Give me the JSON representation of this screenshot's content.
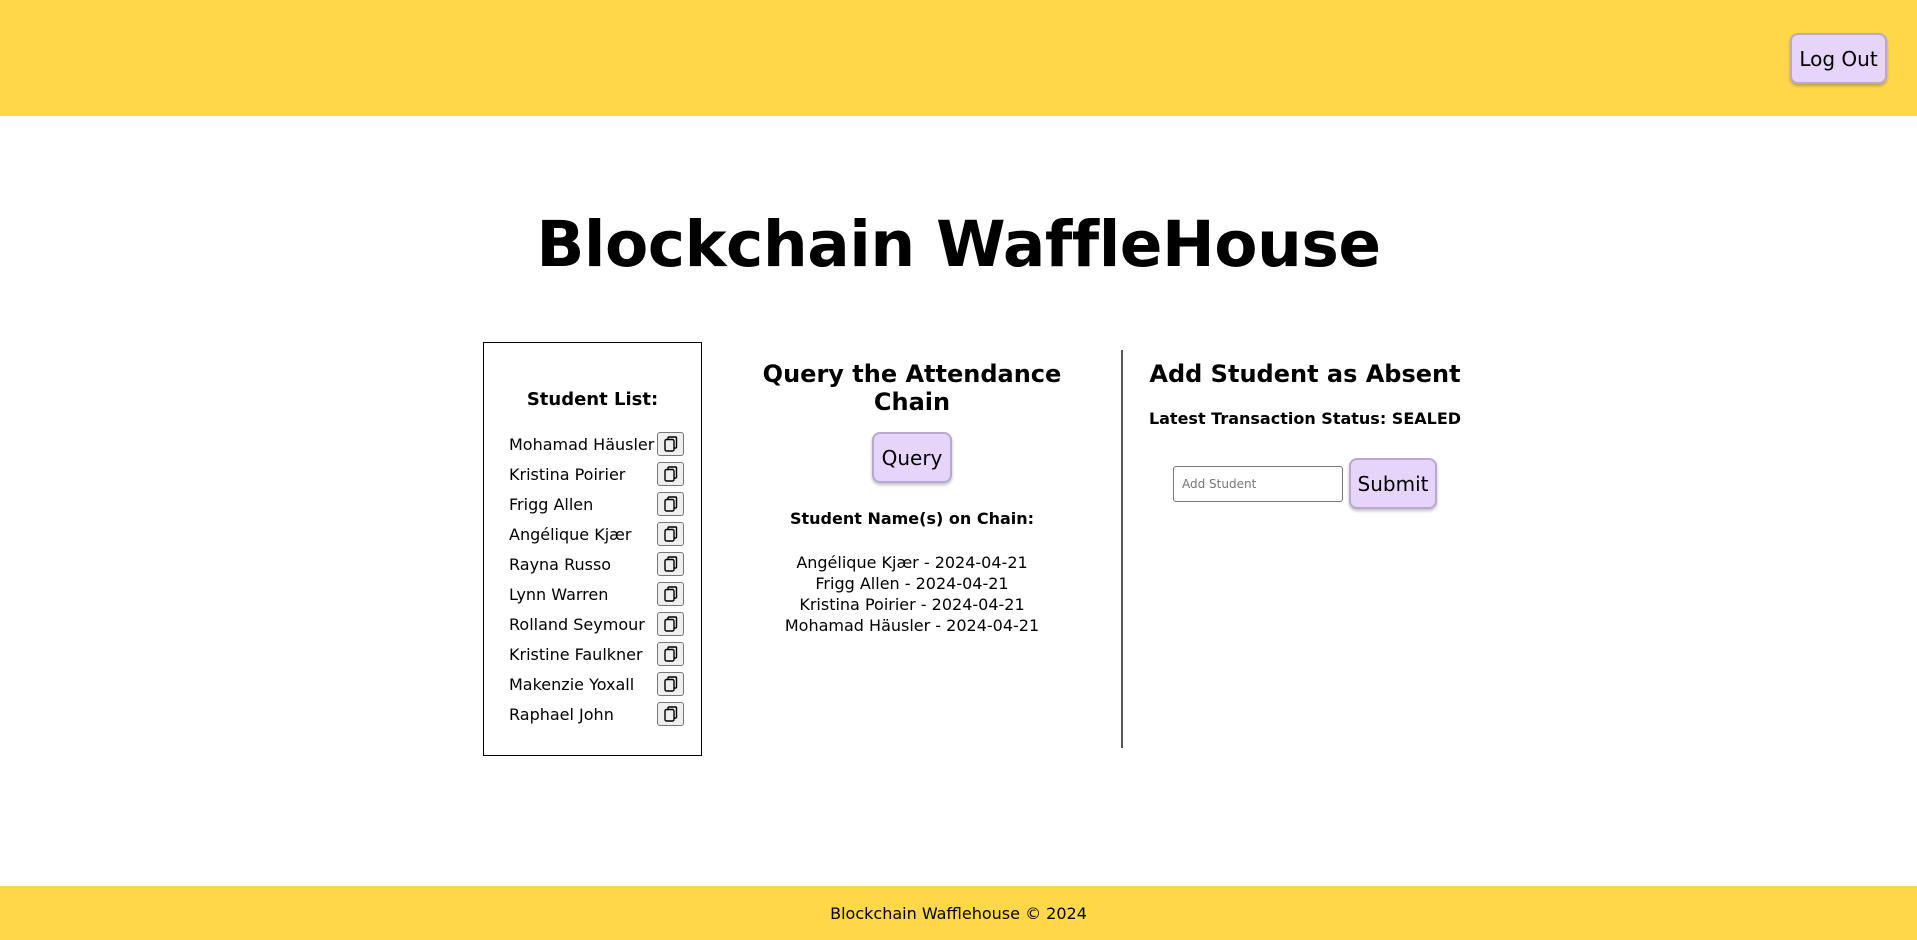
{
  "header": {
    "logout_label": "Log Out"
  },
  "page_title": "Blockchain WaffleHouse",
  "student_panel": {
    "title": "Student List:",
    "students": [
      "Mohamad Häusler",
      "Kristina Poirier",
      "Frigg Allen",
      "Angélique Kjær",
      "Rayna Russo",
      "Lynn Warren",
      "Rolland Seymour",
      "Kristine Faulkner",
      "Makenzie Yoxall",
      "Raphael John"
    ],
    "copy_icon": "copy-icon"
  },
  "query_section": {
    "title": "Query the Attendance Chain",
    "query_label": "Query",
    "chain_label": "Student Name(s) on Chain:",
    "chain_entries": [
      "Angélique Kjær - 2024-04-21",
      "Frigg Allen - 2024-04-21",
      "Kristina Poirier - 2024-04-21",
      "Mohamad Häusler - 2024-04-21"
    ]
  },
  "add_section": {
    "title": "Add Student as Absent",
    "tx_status": "Latest Transaction Status: SEALED",
    "input_placeholder": "Add Student",
    "input_value": "",
    "submit_label": "Submit"
  },
  "footer": {
    "text": "Blockchain Wafflehouse © 2024"
  },
  "colors": {
    "header_bg": "#ffd84a",
    "button_bg": "#e6d4fb",
    "button_border": "#b9a8cf"
  }
}
